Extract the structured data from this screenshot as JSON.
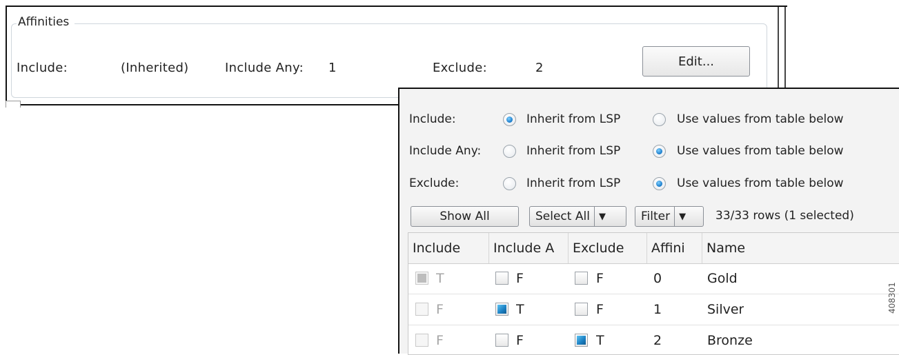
{
  "affinities": {
    "group_title": "Affinities",
    "include_label": "Include:",
    "include_value": "(Inherited)",
    "include_any_label": "Include Any:",
    "include_any_value": "1",
    "exclude_label": "Exclude:",
    "exclude_value": "2",
    "edit_button": "Edit..."
  },
  "popup": {
    "options": [
      {
        "label": "Include:",
        "inherit": "Inherit from LSP",
        "use_values": "Use values from table below",
        "selected": "inherit"
      },
      {
        "label": "Include Any:",
        "inherit": "Inherit from LSP",
        "use_values": "Use values from table below",
        "selected": "use_values"
      },
      {
        "label": "Exclude:",
        "inherit": "Inherit from LSP",
        "use_values": "Use values from table below",
        "selected": "use_values"
      }
    ],
    "toolbar": {
      "show_all": "Show All",
      "select_all": "Select All",
      "filter": "Filter",
      "rows_status": "33/33 rows (1 selected)"
    },
    "table": {
      "columns": [
        "Include",
        "Include A",
        "Exclude",
        "Affini",
        "Name"
      ],
      "rows": [
        {
          "include": "T",
          "include_any": "F",
          "exclude": "F",
          "affinity": "0",
          "name": "Gold"
        },
        {
          "include": "F",
          "include_any": "T",
          "exclude": "F",
          "affinity": "1",
          "name": "Silver"
        },
        {
          "include": "F",
          "include_any": "F",
          "exclude": "T",
          "affinity": "2",
          "name": "Bronze"
        }
      ]
    }
  },
  "figure_id": "408301",
  "colors": {
    "accent": "#1a7fc2",
    "panel_bg": "#f3f3f3",
    "border": "#111111"
  }
}
